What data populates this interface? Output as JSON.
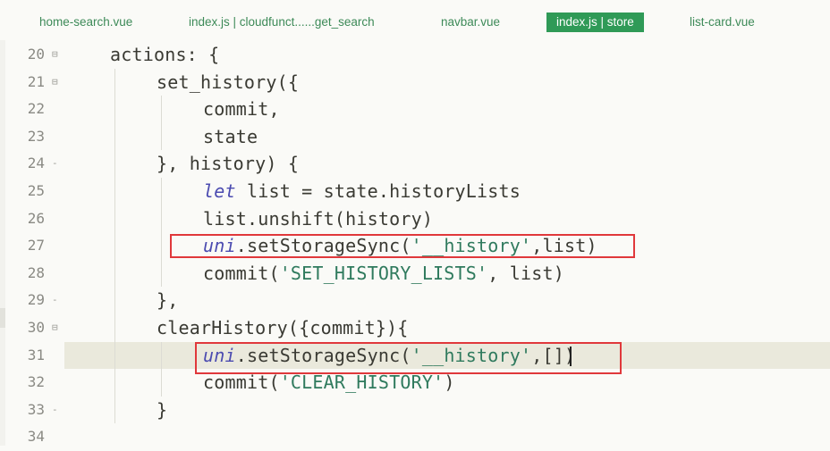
{
  "tabs": [
    {
      "label": "home-search.vue",
      "active": false
    },
    {
      "label": "index.js | cloudfunct......get_search",
      "active": false
    },
    {
      "label": "navbar.vue",
      "active": false
    },
    {
      "label": "index.js | store",
      "active": true
    },
    {
      "label": "list-card.vue",
      "active": false
    }
  ],
  "editor": {
    "current_line": "31",
    "lines": [
      {
        "no": "20",
        "fold": "⊟",
        "tokens": [
          {
            "t": "actions: {",
            "c": "tx"
          }
        ]
      },
      {
        "no": "21",
        "fold": "⊟",
        "tokens": [
          {
            "t": "set_history({",
            "c": "tx"
          }
        ]
      },
      {
        "no": "22",
        "fold": "",
        "tokens": [
          {
            "t": "commit,",
            "c": "tx"
          }
        ]
      },
      {
        "no": "23",
        "fold": "",
        "tokens": [
          {
            "t": "state",
            "c": "tx"
          }
        ]
      },
      {
        "no": "24",
        "fold": "-",
        "tokens": [
          {
            "t": "}, history) {",
            "c": "tx"
          }
        ]
      },
      {
        "no": "25",
        "fold": "",
        "tokens": [
          {
            "t": "let",
            "c": "kw"
          },
          {
            "t": " list = state.historyLists",
            "c": "tx"
          }
        ]
      },
      {
        "no": "26",
        "fold": "",
        "tokens": [
          {
            "t": "list.unshift(history)",
            "c": "tx"
          }
        ]
      },
      {
        "no": "27",
        "fold": "",
        "tokens": [
          {
            "t": "uni",
            "c": "kw"
          },
          {
            "t": ".setStorageSync(",
            "c": "tx"
          },
          {
            "t": "'__history'",
            "c": "str"
          },
          {
            "t": ",list)",
            "c": "tx"
          }
        ]
      },
      {
        "no": "28",
        "fold": "",
        "tokens": [
          {
            "t": "commit(",
            "c": "tx"
          },
          {
            "t": "'SET_HISTORY_LISTS'",
            "c": "str"
          },
          {
            "t": ", list)",
            "c": "tx"
          }
        ]
      },
      {
        "no": "29",
        "fold": "-",
        "tokens": [
          {
            "t": "},",
            "c": "tx"
          }
        ]
      },
      {
        "no": "30",
        "fold": "⊟",
        "tokens": [
          {
            "t": "clearHistory({commit}){",
            "c": "tx"
          }
        ]
      },
      {
        "no": "31",
        "fold": "",
        "tokens": [
          {
            "t": "uni",
            "c": "kw"
          },
          {
            "t": ".setStorageSync(",
            "c": "tx"
          },
          {
            "t": "'__history'",
            "c": "str"
          },
          {
            "t": ",[])",
            "c": "tx"
          }
        ]
      },
      {
        "no": "32",
        "fold": "",
        "tokens": [
          {
            "t": "commit(",
            "c": "tx"
          },
          {
            "t": "'CLEAR_HISTORY'",
            "c": "str"
          },
          {
            "t": ")",
            "c": "tx"
          }
        ]
      },
      {
        "no": "33",
        "fold": "-",
        "tokens": [
          {
            "t": "}",
            "c": "tx"
          }
        ]
      },
      {
        "no": "34",
        "fold": "",
        "tokens": []
      }
    ]
  },
  "colors": {
    "active_tab": "#2f9a57",
    "keyword": "#4b4bb0",
    "string": "#2f7a5d",
    "annotation_box": "#e0383b"
  }
}
